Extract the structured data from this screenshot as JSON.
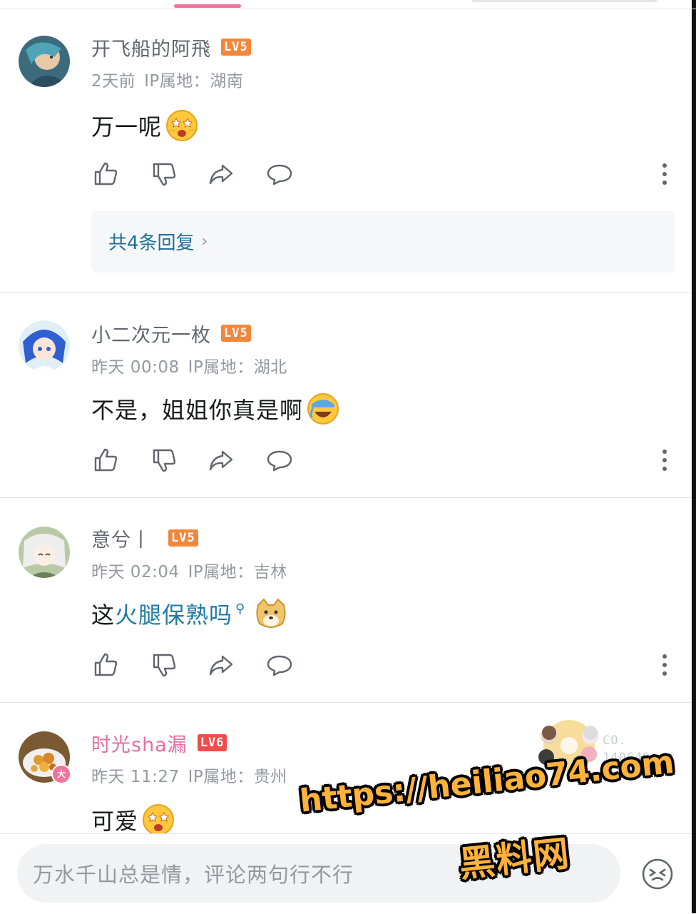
{
  "comments": [
    {
      "username": "开飞船的阿飛",
      "level": "LV5",
      "time": "2天前",
      "ip": "IP属地：湖南",
      "text": "万一呢",
      "emoji": "star-eyes-emoji",
      "replies_label": "共4条回复"
    },
    {
      "username": "小二次元一枚",
      "level": "LV5",
      "time": "昨天 00:08",
      "ip": "IP属地：湖北",
      "text": "不是，姐姐你真是啊",
      "emoji": "laugh-cry-emoji"
    },
    {
      "username": "意兮丨",
      "level": "LV5",
      "time": "昨天 02:04",
      "ip": "IP属地：吉林",
      "text_prefix": "这",
      "text_keyword": "火腿保熟吗",
      "emoji": "doge-emoji"
    },
    {
      "username": "时光sha漏",
      "level": "LV6",
      "time": "昨天 11:27",
      "ip": "IP属地：贵州",
      "text": "可爱",
      "emoji": "star-eyes-emoji",
      "avatar_badge": "大",
      "seal_line1": "CO.",
      "seal_line2": "140649"
    }
  ],
  "input": {
    "placeholder": "万水千山总是情，评论两句行不行"
  },
  "watermark": {
    "url": "https://heiliao74.com",
    "site": "黑料网"
  },
  "colors": {
    "accent_pink": "#f0739b",
    "level5": "#f2873b",
    "level6": "#f04c49",
    "link_blue": "#1f7aa8"
  }
}
